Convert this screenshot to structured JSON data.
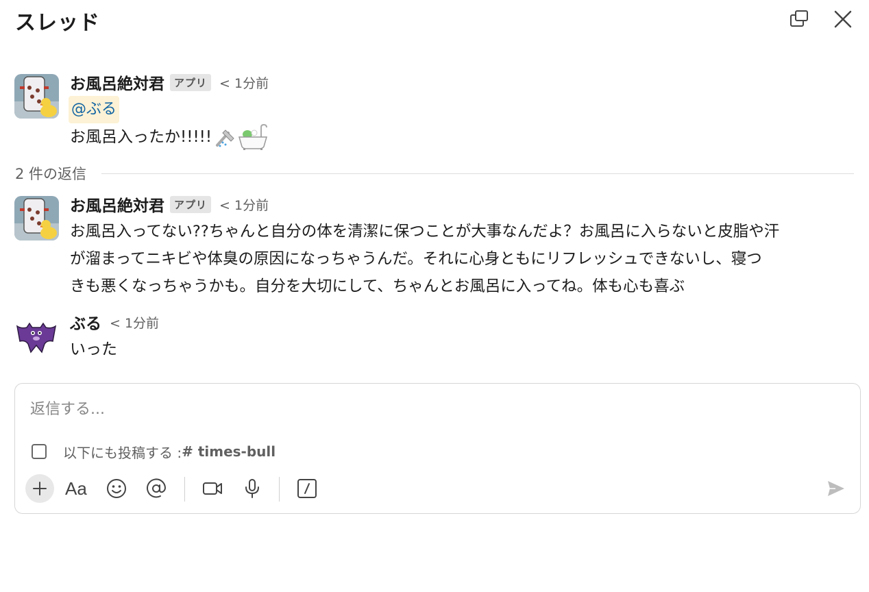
{
  "header": {
    "title": "スレッド",
    "popout_icon": "popout-icon",
    "close_icon": "close-icon"
  },
  "parent_message": {
    "sender": "お風呂絶対君",
    "badge": "アプリ",
    "time": "< 1分前",
    "mention": "@ぶる",
    "text": "お風呂入ったか!!!!!",
    "emojis": [
      "shower-icon",
      "bathtub-icon"
    ]
  },
  "replies": {
    "count_label": "2 件の返信"
  },
  "reply_messages": [
    {
      "sender": "お風呂絶対君",
      "badge": "アプリ",
      "time": "< 1分前",
      "lines": [
        "お風呂入ってない??ちゃんと自分の体を清潔に保つことが大事なんだよ？お風呂に入らないと皮脂や汗",
        "が溜まってニキビや体臭の原因になっちゃうんだ。それに心身ともにリフレッシュできないし、寝つ",
        "きも悪くなっちゃうかも。自分を大切にして、ちゃんとお風呂に入ってね。体も心も喜ぶ"
      ]
    },
    {
      "sender": "ぶる",
      "time": "< 1分前",
      "text": "いった"
    }
  ],
  "composer": {
    "placeholder": "返信する...",
    "also_post_label": "以下にも投稿する :",
    "also_post_channel": "# times-bull",
    "toolbar": [
      "plus-icon",
      "text-format-icon",
      "emoji-icon",
      "mention-icon",
      "video-icon",
      "microphone-icon",
      "slash-command-icon",
      "send-icon"
    ]
  }
}
